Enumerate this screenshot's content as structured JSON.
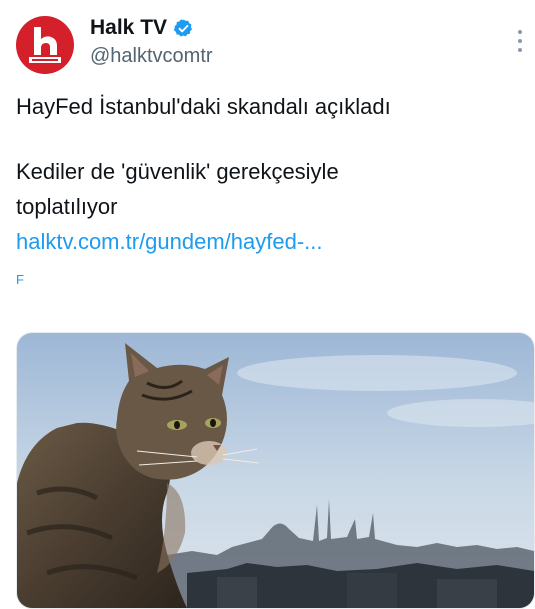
{
  "author": {
    "display_name": "Halk TV",
    "handle": "@halktvcomtr",
    "verified_icon": "verified-badge-icon",
    "avatar_logo_text": "HALK TV",
    "avatar_color": "#d3202a"
  },
  "tweet": {
    "line1": "HayFed İstanbul'daki skandalı açıkladı",
    "line2": "Kediler de 'güvenlik' gerekçesiyle",
    "line3": "toplatılıyor",
    "link": "halktv.com.tr/gundem/hayfed-...",
    "stub": "F"
  },
  "colors": {
    "link": "#1d9bf0",
    "verified": "#1d9bf0",
    "text": "#0f1419",
    "secondary": "#536471"
  },
  "icons": {
    "more": "more-options-icon"
  },
  "media": {
    "image_subject": "cat-photo"
  }
}
